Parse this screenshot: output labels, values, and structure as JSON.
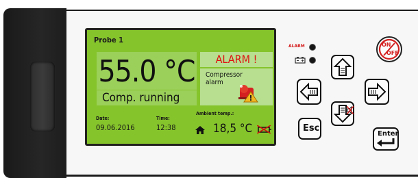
{
  "display": {
    "probe_label": "Probe 1",
    "temperature": "55.0 °C",
    "status": "Comp. running",
    "alarm": "ALARM !",
    "alarm_detail_line1": "Compressor",
    "alarm_detail_line2": "alarm",
    "date_label": "Date:",
    "date_value": "09.06.2016",
    "time_label": "Time:",
    "time_value": "12:38",
    "ambient_label": "Ambient temp.:",
    "ambient_value": "18,5 °C"
  },
  "indicators": {
    "alarm_label": "ALARM"
  },
  "keypad": {
    "on_label": "ON",
    "off_label": "OFF",
    "esc_label": "Esc",
    "enter_label": "Enter"
  },
  "colors": {
    "screen_green": "#86c42c",
    "alarm_red": "#e01010"
  }
}
